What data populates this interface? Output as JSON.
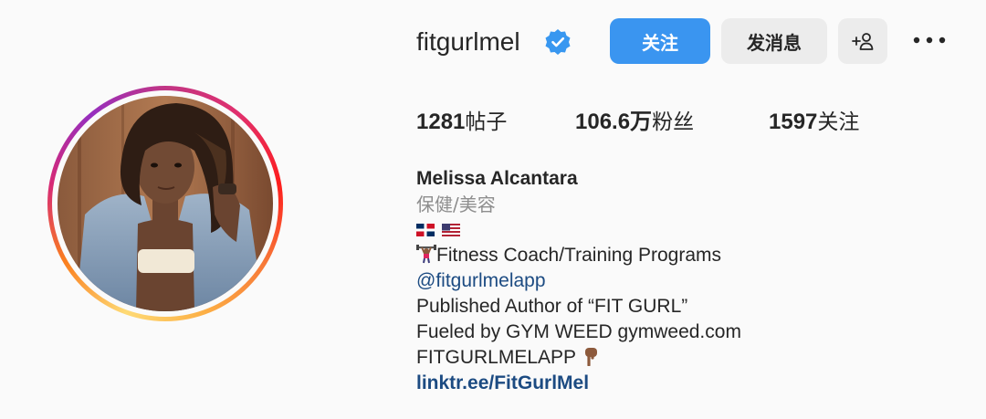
{
  "profile": {
    "username": "fitgurlmel",
    "verified": true,
    "buttons": {
      "follow": "关注",
      "message": "发消息"
    },
    "stats": {
      "posts_count": "1281",
      "posts_label": "帖子",
      "followers_count": "106.6万",
      "followers_label": "粉丝",
      "following_count": "1597",
      "following_label": "关注"
    },
    "bio": {
      "name": "Melissa Alcantara",
      "category": "保健/美容",
      "line_fitness": "Fitness Coach/Training Programs",
      "mention": "@fitgurlmelapp",
      "author": "Published Author of “FIT GURL”",
      "fueled": "Fueled by GYM WEED gymweed.com",
      "app": "FITGURLMELAPP",
      "website": "linktr.ee/FitGurlMel"
    }
  },
  "icons": {
    "verified": "verified-badge-icon",
    "suggest": "add-person-icon",
    "more": "more-horizontal-icon",
    "flags": [
      "dominican-republic-flag",
      "united-states-flag"
    ],
    "weightlifter": "weightlifter-emoji",
    "point_down": "pointing-down-emoji"
  },
  "colors": {
    "accent": "#3a95f0",
    "link": "#1c4b82",
    "verified": "#3897f0",
    "muted": "#8e8e8e"
  }
}
